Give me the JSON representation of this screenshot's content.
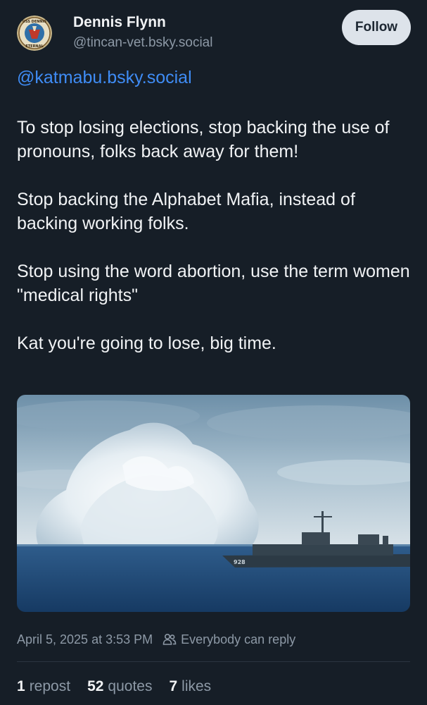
{
  "author": {
    "display_name": "Dennis Flynn",
    "handle": "@tincan-vet.bsky.social",
    "avatar_text_top": "USS DENNIS",
    "avatar_text_bottom": "ETERNAL"
  },
  "follow_label": "Follow",
  "post": {
    "mention": "@katmabu.bsky.social",
    "paragraphs": [
      "To stop losing elections, stop backing the use of pronouns, folks back away for them!",
      "Stop backing the Alphabet Mafia, instead of backing working folks.",
      "Stop using the word abortion, use the term women \"medical rights\"",
      "Kat you're going to lose, big time."
    ],
    "image": {
      "description_icon": "photo",
      "hull_number": "928"
    }
  },
  "meta": {
    "timestamp": "April 5, 2025 at 3:53 PM",
    "reply_setting": "Everybody can reply"
  },
  "stats": {
    "reposts_count": "1",
    "reposts_label": "repost",
    "quotes_count": "52",
    "quotes_label": "quotes",
    "likes_count": "7",
    "likes_label": "likes"
  },
  "colors": {
    "background": "#161e27",
    "link": "#3f8cf5",
    "muted": "#8d99a6",
    "follow_bg": "#dde3ea"
  }
}
